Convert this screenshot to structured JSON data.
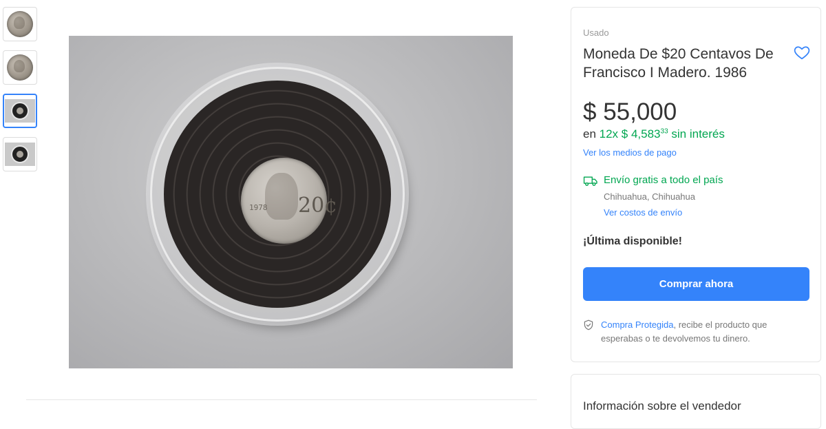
{
  "gallery": {
    "thumbnails": [
      {
        "icon": "coin-front-thumbnail"
      },
      {
        "icon": "coin-back-thumbnail"
      },
      {
        "icon": "coin-capsule-thumbnail",
        "selected": true
      },
      {
        "icon": "coin-capsule-thumbnail-alt"
      }
    ],
    "main_image": {
      "coin_year_text": "1978",
      "coin_value_text": "20¢"
    }
  },
  "product": {
    "condition": "Usado",
    "title": "Moneda De $20 Centavos De Francisco I Madero. 1986",
    "price": "$ 55,000",
    "installments": {
      "prefix": "en ",
      "count": "12x",
      "amount": "$ 4,583",
      "cents": "33",
      "suffix": " sin interés"
    },
    "payment_methods_link": "Ver los medios de pago",
    "shipping": {
      "title": "Envío gratis a todo el país",
      "location": "Chihuahua, Chihuahua",
      "costs_link": "Ver costos de envío"
    },
    "stock_notice": "¡Última disponible!",
    "buy_button": "Comprar ahora",
    "protection": {
      "link": "Compra Protegida",
      "text": ", recibe el producto que esperabas o te devolvemos tu dinero."
    }
  },
  "seller": {
    "title": "Información sobre el vendedor"
  },
  "colors": {
    "accent_blue": "#3483fa",
    "success_green": "#00a650"
  },
  "icons": {
    "favorite": "heart-icon",
    "shipping": "truck-icon",
    "protection": "shield-check-icon"
  }
}
